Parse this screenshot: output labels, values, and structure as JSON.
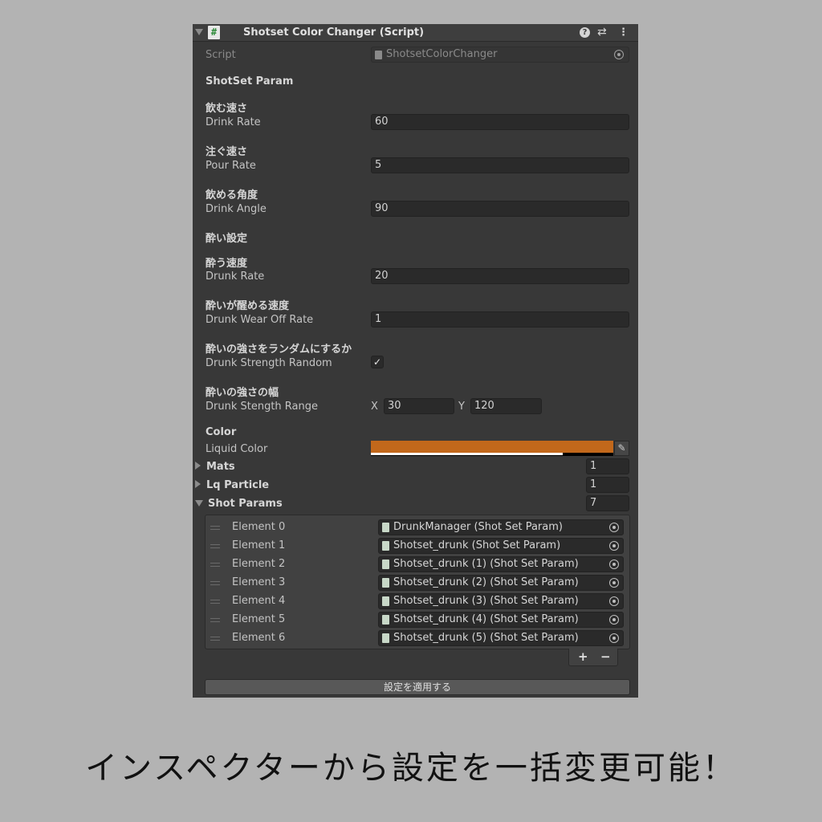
{
  "component": {
    "title": "Shotset Color Changer (Script)",
    "script_icon": "#",
    "help_icon": "?",
    "preset_icon": "⇄",
    "more_icon": "⋮"
  },
  "script": {
    "label": "Script",
    "value": "ShotsetColorChanger"
  },
  "section_shotset": "ShotSet Param",
  "drink_rate": {
    "jp": "飲む速さ",
    "label": "Drink Rate",
    "value": "60"
  },
  "pour_rate": {
    "jp": "注ぐ速さ",
    "label": "Pour Rate",
    "value": "5"
  },
  "drink_angle": {
    "jp": "飲める角度",
    "label": "Drink Angle",
    "value": "90"
  },
  "section_drunk": "酔い設定",
  "drunk_rate": {
    "jp": "酔う速度",
    "label": "Drunk Rate",
    "value": "20"
  },
  "drunk_wear_off": {
    "jp": "酔いが醒める速度",
    "label": "Drunk Wear Off Rate",
    "value": "1"
  },
  "drunk_random": {
    "jp": "酔いの強さをランダムにするか",
    "label": "Drunk Strength Random",
    "checked": true,
    "check_mark": "✓"
  },
  "drunk_range": {
    "jp": "酔いの強さの幅",
    "label": "Drunk Stength Range",
    "x_label": "X",
    "x": "30",
    "y_label": "Y",
    "y": "120"
  },
  "color": {
    "header": "Color",
    "label": "Liquid Color",
    "value": "#c2681b",
    "alpha": 0.79,
    "picker_icon": "✎"
  },
  "mats": {
    "label": "Mats",
    "size": "1"
  },
  "lq_particle": {
    "label": "Lq Particle",
    "size": "1"
  },
  "shot_params": {
    "label": "Shot Params",
    "size": "7",
    "elements": [
      {
        "label": "Element 0",
        "value": "DrunkManager (Shot Set Param)"
      },
      {
        "label": "Element 1",
        "value": "Shotset_drunk (Shot Set Param)"
      },
      {
        "label": "Element 2",
        "value": "Shotset_drunk (1) (Shot Set Param)"
      },
      {
        "label": "Element 3",
        "value": "Shotset_drunk (2) (Shot Set Param)"
      },
      {
        "label": "Element 4",
        "value": "Shotset_drunk (3) (Shot Set Param)"
      },
      {
        "label": "Element 5",
        "value": "Shotset_drunk (4) (Shot Set Param)"
      },
      {
        "label": "Element 6",
        "value": "Shotset_drunk (5) (Shot Set Param)"
      }
    ],
    "add": "+",
    "remove": "−"
  },
  "apply_button": "設定を適用する",
  "caption": "インスペクターから設定を一括変更可能！"
}
